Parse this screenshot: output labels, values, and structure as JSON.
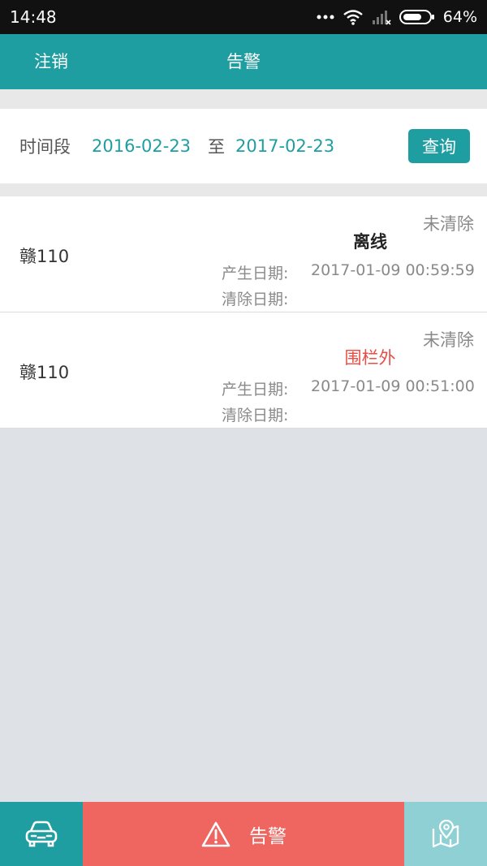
{
  "status_bar": {
    "time": "14:48",
    "battery": "64%"
  },
  "header": {
    "logout_label": "注销",
    "title": "告警"
  },
  "filter": {
    "label": "时间段",
    "start_date": "2016-02-23",
    "to_label": "至",
    "end_date": "2017-02-23",
    "query_label": "查询"
  },
  "alarms": [
    {
      "plate": "赣110",
      "status": "未清除",
      "type": "离线",
      "created_label": "产生日期:",
      "created_value": "2017-01-09 00:59:59",
      "cleared_label": "清除日期:",
      "cleared_value": ""
    },
    {
      "plate": "赣110",
      "status": "未清除",
      "type": "围栏外",
      "created_label": "产生日期:",
      "created_value": "2017-01-09 00:51:00",
      "cleared_label": "清除日期:",
      "cleared_value": ""
    }
  ],
  "tabs": {
    "alarm_label": "告警"
  },
  "colors": {
    "primary": "#1f9ea1",
    "alarm_tab": "#ef6560",
    "map_tab": "#8ed0d3",
    "fence_alert": "#e84c43"
  },
  "icons": {
    "car_tab": "car-icon",
    "alarm_tab": "warning-triangle-icon",
    "map_tab": "map-pin-icon"
  }
}
